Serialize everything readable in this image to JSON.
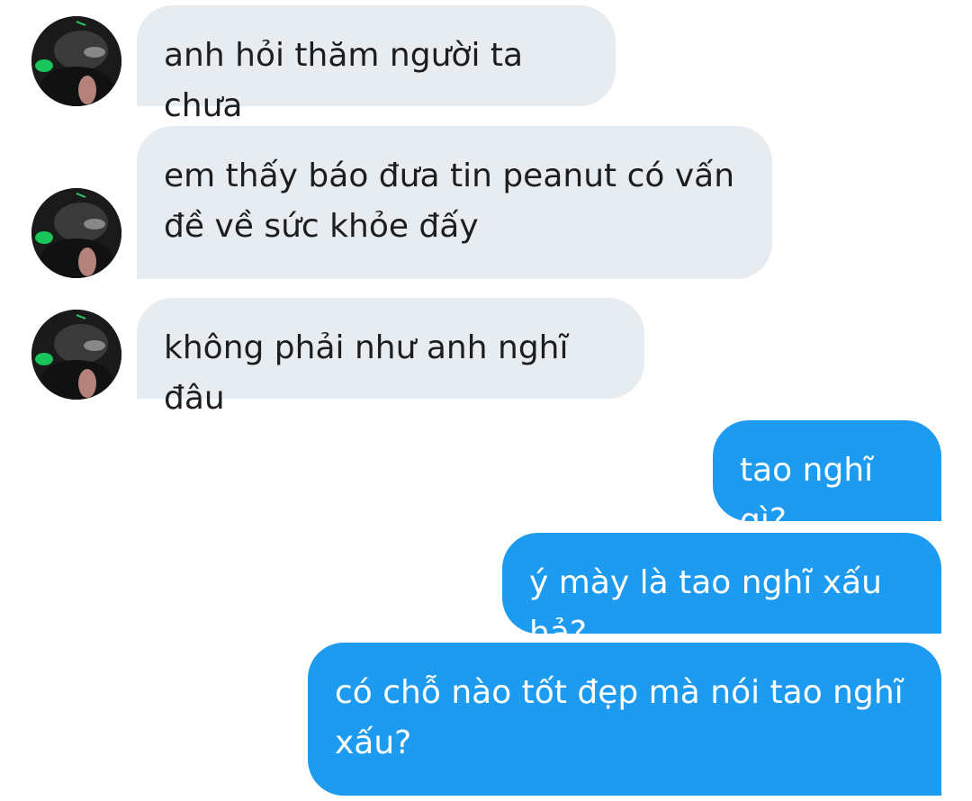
{
  "conversation": {
    "messages": [
      {
        "direction": "incoming",
        "text": "anh hỏi thăm người ta chưa"
      },
      {
        "direction": "incoming",
        "text": "em thấy báo đưa tin peanut có vấn\nđề về sức khỏe đấy"
      },
      {
        "direction": "incoming",
        "text": "không phải như anh nghĩ đâu"
      },
      {
        "direction": "outgoing",
        "text": "tao nghĩ gì?"
      },
      {
        "direction": "outgoing",
        "text": "ý mày là tao nghĩ xấu hả?"
      },
      {
        "direction": "outgoing",
        "text": "có chỗ nào tốt đẹp mà nói tao nghĩ\nxấu?"
      }
    ]
  },
  "colors": {
    "incoming_bubble": "#e7ecf0",
    "incoming_text": "#1b1e21",
    "outgoing_bubble": "#1d9bf0",
    "outgoing_text": "#ffffff",
    "background": "#ffffff"
  },
  "icons": {
    "avatar": "contact-avatar-photo"
  }
}
